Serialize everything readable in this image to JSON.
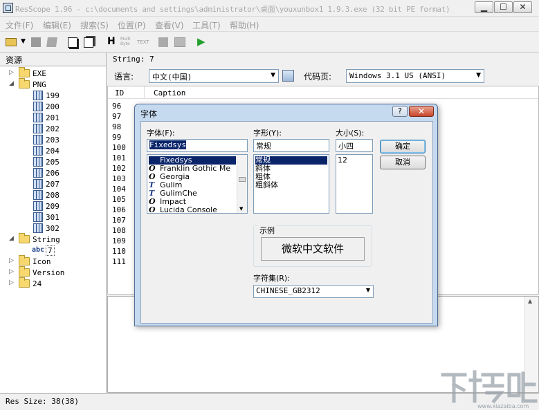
{
  "window": {
    "title": "ResScope 1.96 - c:\\documents and settings\\administrator\\桌面\\youxunbox1 1.9.3.exe (32 bit PE format)",
    "min": "▁",
    "max": "☐",
    "close": "✕"
  },
  "menu": [
    "文件(F)",
    "编辑(E)",
    "搜索(S)",
    "位置(P)",
    "查看(V)",
    "工具(T)",
    "帮助(H)"
  ],
  "toolbar": {
    "multibyte": "Multi Byte",
    "text": "TEXT",
    "h": "H",
    "run": "▶"
  },
  "tree": {
    "header": "资源",
    "nodes": [
      {
        "label": "EXE",
        "kind": "folder",
        "expander": "▷"
      },
      {
        "label": "PNG",
        "kind": "folder",
        "expander": "◢"
      },
      {
        "label": "199",
        "kind": "res"
      },
      {
        "label": "200",
        "kind": "res"
      },
      {
        "label": "201",
        "kind": "res"
      },
      {
        "label": "202",
        "kind": "res"
      },
      {
        "label": "203",
        "kind": "res"
      },
      {
        "label": "204",
        "kind": "res"
      },
      {
        "label": "205",
        "kind": "res"
      },
      {
        "label": "206",
        "kind": "res"
      },
      {
        "label": "207",
        "kind": "res"
      },
      {
        "label": "208",
        "kind": "res"
      },
      {
        "label": "209",
        "kind": "res"
      },
      {
        "label": "301",
        "kind": "res"
      },
      {
        "label": "302",
        "kind": "res"
      },
      {
        "label": "String",
        "kind": "folder",
        "expander": "◢"
      },
      {
        "label": "7",
        "kind": "abc",
        "icon": "abc"
      },
      {
        "label": "Icon",
        "kind": "folder",
        "expander": "▷"
      },
      {
        "label": "Version",
        "kind": "folder",
        "expander": "▷"
      },
      {
        "label": "24",
        "kind": "folder",
        "expander": "▷"
      }
    ]
  },
  "string_header": "String: 7",
  "language": {
    "label": "语言:",
    "value": "中文(中国)",
    "codepage_label": "代码页:",
    "codepage_value": "Windows 3.1 US (ANSI)"
  },
  "grid": {
    "col_id": "ID",
    "col_caption": "Caption",
    "rows": [
      "96",
      "97",
      "98",
      "99",
      "100",
      "101",
      "102",
      "103",
      "104",
      "105",
      "106",
      "107",
      "108",
      "109",
      "110",
      "111"
    ]
  },
  "status": "Res Size: 38(38)",
  "watermark": {
    "text": "下载吧",
    "url": "www.xiazaiba.com"
  },
  "dialog": {
    "title": "字体",
    "help": "?",
    "close": "✕",
    "font_label": "字体(F):",
    "font_value": "Fixedsys",
    "fonts": [
      {
        "name": "Fixedsys",
        "icon": "",
        "selected": true
      },
      {
        "name": "Franklin Gothic Me",
        "icon": "O"
      },
      {
        "name": "Georgia",
        "icon": "O"
      },
      {
        "name": "Gulim",
        "icon": "T"
      },
      {
        "name": "GulimChe",
        "icon": "T"
      },
      {
        "name": "Impact",
        "icon": "O"
      },
      {
        "name": "Lucida Console",
        "icon": "O"
      }
    ],
    "style_label": "字形(Y):",
    "style_value": "常规",
    "styles": [
      {
        "name": "常规",
        "selected": true
      },
      {
        "name": "斜体"
      },
      {
        "name": "粗体"
      },
      {
        "name": "粗斜体"
      }
    ],
    "size_label": "大小(S):",
    "size_value": "小四",
    "sizes": [
      "12"
    ],
    "ok": "确定",
    "cancel": "取消",
    "sample_label": "示例",
    "sample_text": "微软中文软件",
    "charset_label": "字符集(R):",
    "charset_value": "CHINESE_GB2312"
  }
}
